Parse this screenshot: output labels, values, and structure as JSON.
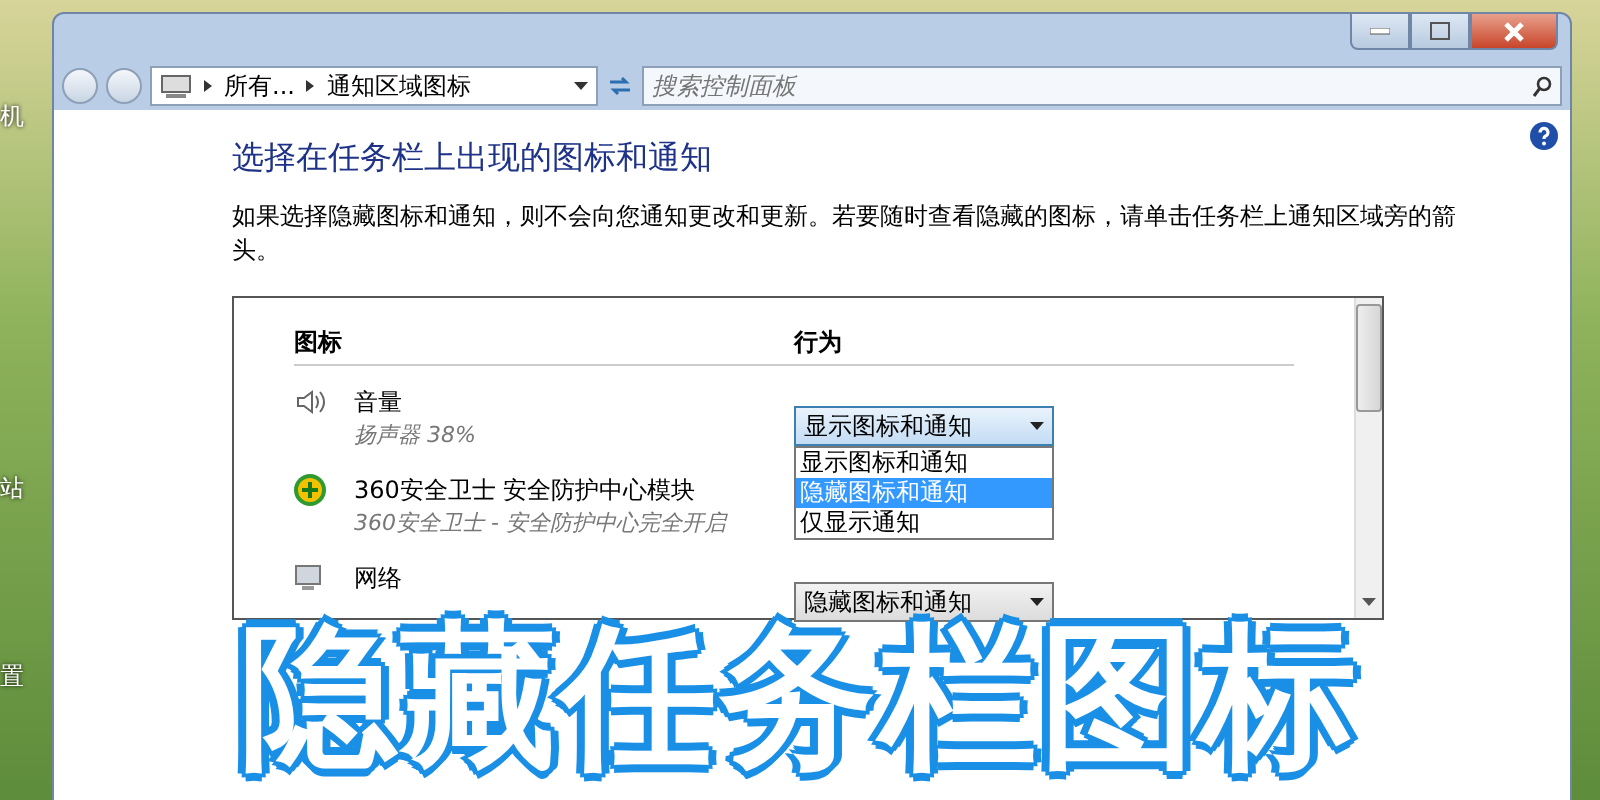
{
  "desktop": {
    "icon_labels": [
      "机",
      "站",
      "置"
    ]
  },
  "address_bar": {
    "crumbs": [
      "所有...",
      "通知区域图标"
    ]
  },
  "search": {
    "placeholder": "搜索控制面板"
  },
  "heading": "选择在任务栏上出现的图标和通知",
  "description": "如果选择隐藏图标和通知，则不会向您通知更改和更新。若要随时查看隐藏的图标，请单击任务栏上通知区域旁的箭头。",
  "table": {
    "columns": [
      "图标",
      "行为"
    ],
    "rows": [
      {
        "kind": "speaker",
        "name": "音量",
        "detail": "扬声器 38%",
        "behavior": "显示图标和通知",
        "expanded": true,
        "options": [
          {
            "label": "显示图标和通知",
            "selected": false
          },
          {
            "label": "隐藏图标和通知",
            "selected": true
          },
          {
            "label": "仅显示通知",
            "selected": false
          }
        ]
      },
      {
        "kind": "shield",
        "name": "360安全卫士 安全防护中心模块",
        "detail": "360安全卫士 - 安全防护中心完全开启"
      },
      {
        "kind": "network",
        "name": "网络",
        "behavior": "隐藏图标和通知",
        "expanded": false
      }
    ]
  },
  "caption": "隐藏任务栏图标"
}
